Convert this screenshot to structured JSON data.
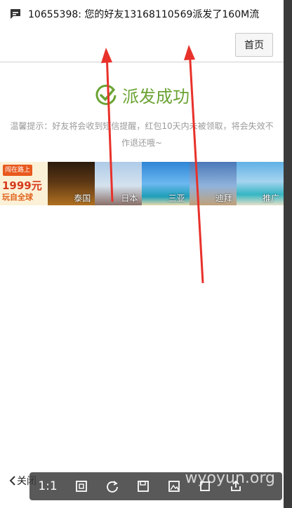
{
  "notification": {
    "text": "10655398: 您的好友13168110569派发了160M流",
    "icon": "message-icon"
  },
  "header": {
    "home_label": "首页"
  },
  "success": {
    "title": "派发成功",
    "icon": "check-circle-icon",
    "color": "#6aa333"
  },
  "tip": {
    "text": "温馨提示：好友将会收到短信提醒，红包10天内未被领取，将会失效不作退还哦~"
  },
  "banner": {
    "promo": {
      "tag": "闯在路上",
      "price": "1999元",
      "sub": "玩自全球"
    },
    "tiles": [
      {
        "label": "泰国"
      },
      {
        "label": "日本"
      },
      {
        "label": "三亚"
      },
      {
        "label": "迪拜"
      },
      {
        "label": "推广"
      }
    ]
  },
  "bottom": {
    "back_label": "关闭",
    "toolbar": {
      "ratio": "1:1",
      "watermark": "wyoyun.org"
    }
  }
}
